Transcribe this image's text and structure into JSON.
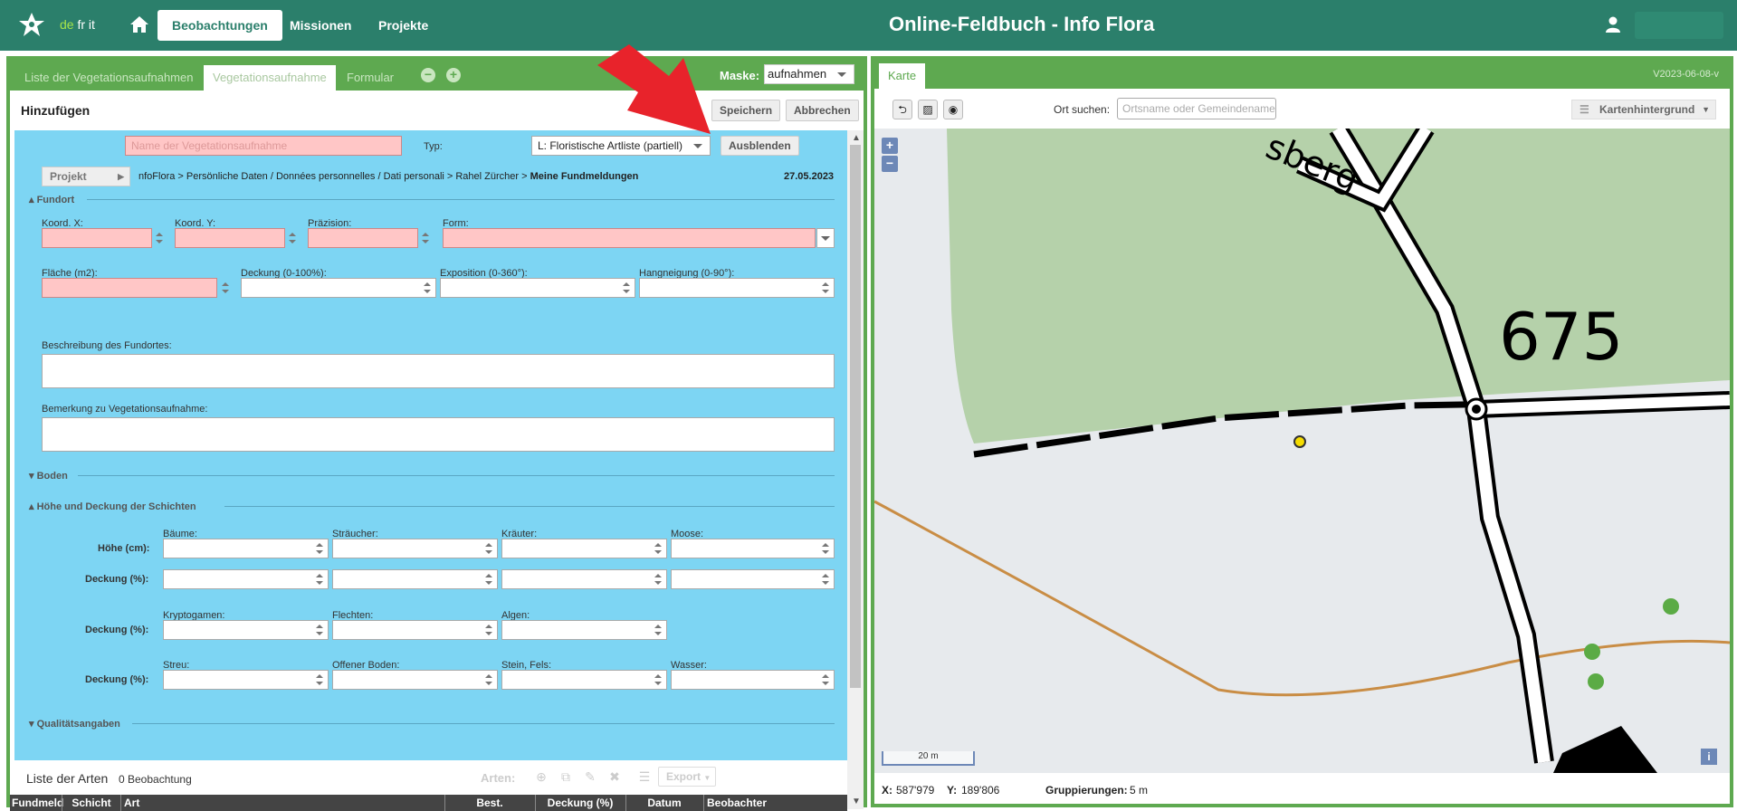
{
  "header": {
    "lang_de": "de",
    "lang_fr": "fr",
    "lang_it": "it",
    "nav_beobachtungen": "Beobachtungen",
    "nav_missionen": "Missionen",
    "nav_projekte": "Projekte",
    "title": "Online-Feldbuch  -  Info Flora"
  },
  "left": {
    "tabs": [
      "Liste der Vegetationsaufnahmen",
      "Vegetationsaufnahme",
      "Formular"
    ],
    "maske_label": "Maske:",
    "maske_value": "aufnahmen",
    "heading": "Hinzufügen",
    "save": "Speichern",
    "cancel": "Abbrechen",
    "name_placeholder": "Name der Vegetationsaufnahme",
    "typ_label": "Typ:",
    "typ_value": "L: Floristische Artliste (partiell)",
    "hide": "Ausblenden",
    "projekt_btn": "Projekt",
    "path": "nfoFlora > Persönliche Daten / Données personnelles / Dati personali > Rahel Zürcher > ",
    "path_bold": "Meine Fundmeldungen",
    "date": "27.05.2023",
    "sec_fundort": "Fundort",
    "koord_x": "Koord. X:",
    "koord_y": "Koord. Y:",
    "praezision": "Präzision:",
    "form": "Form:",
    "flaeche": "Fläche (m2):",
    "deckung": "Deckung (0-100%):",
    "exposition": "Exposition (0-360°):",
    "hangneigung": "Hangneigung (0-90°):",
    "beschreibung": "Beschreibung des Fundortes:",
    "bemerkung": "Bemerkung zu Vegetationsaufnahme:",
    "sec_boden": "Boden",
    "sec_hoehe": "Höhe und Deckung der Schichten",
    "baeume": "Bäume:",
    "straeucher": "Sträucher:",
    "kraeuter": "Kräuter:",
    "moose": "Moose:",
    "hoehe_cm": "Höhe (cm):",
    "deckung_pct": "Deckung (%):",
    "kryptogamen": "Kryptogamen:",
    "flechten": "Flechten:",
    "algen": "Algen:",
    "streu": "Streu:",
    "offener_boden": "Offener Boden:",
    "stein_fels": "Stein, Fels:",
    "wasser": "Wasser:",
    "sec_qualitaet": "Qualitätsangaben",
    "liste_arten": "Liste der Arten",
    "beob_count": "0 Beobachtung",
    "arten_label": "Arten:",
    "export": "Export",
    "columns": [
      "Fundmeld",
      "Schicht",
      "Art",
      "Best.",
      "Deckung (%)",
      "Datum",
      "Beobachter"
    ]
  },
  "right": {
    "tab_karte": "Karte",
    "version": "V2023-06-08-v",
    "ort_label": "Ort suchen:",
    "ort_placeholder": "Ortsname oder Gemeindename eing",
    "kartenhintergrund": "Kartenhintergrund",
    "map_label_675": "675",
    "map_label_berg": "sberg",
    "scale": "20 m",
    "x_label": "X:",
    "x_value": "587'979",
    "y_label": "Y:",
    "y_value": "189'806",
    "grupp_label": "Gruppierungen:",
    "grupp_value": "5 m"
  },
  "colors": {
    "header_bg": "#2b7f6b",
    "panel_border": "#5ea950",
    "form_bg": "#7dd5f3",
    "required_field": "#ffc6c6",
    "map_forest": "#b5d1aa",
    "trail": "#c98d45",
    "marker": "#f5dc00",
    "arrow": "#e8232b"
  }
}
